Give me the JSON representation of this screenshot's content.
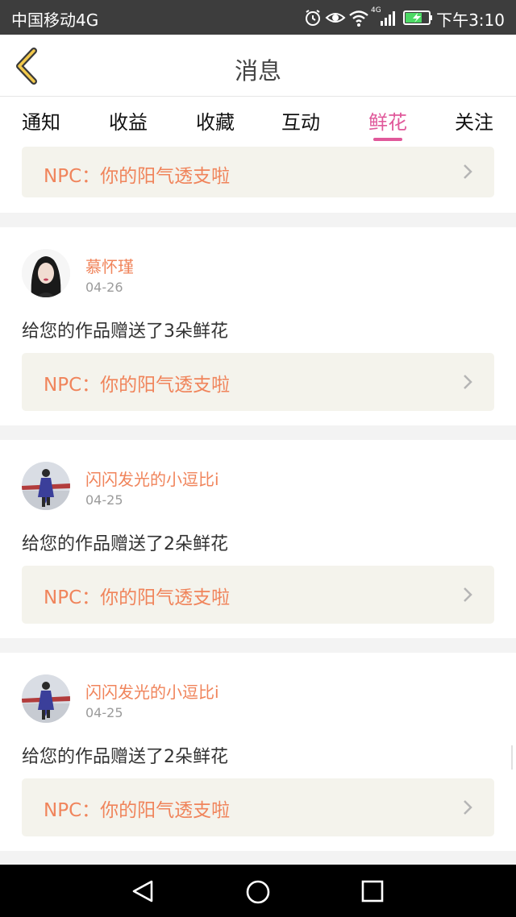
{
  "status_bar": {
    "carrier": "中国移动4G",
    "network_badge": "4G",
    "time": "下午3:10"
  },
  "header": {
    "title": "消息"
  },
  "tabs": [
    {
      "label": "通知",
      "active": false
    },
    {
      "label": "收益",
      "active": false
    },
    {
      "label": "收藏",
      "active": false
    },
    {
      "label": "互动",
      "active": false
    },
    {
      "label": "鲜花",
      "active": true
    },
    {
      "label": "关注",
      "active": false
    }
  ],
  "accent_color": "#e0589a",
  "name_color": "#f0845b",
  "top_partial_card": {
    "npc": "NPC：你的阳气透支啦"
  },
  "messages": [
    {
      "username": "慕怀瑾",
      "date": "04-26",
      "text": "给您的作品赠送了3朵鲜花",
      "npc": "NPC：你的阳气透支啦"
    },
    {
      "username": "闪闪发光的小逗比i",
      "date": "04-25",
      "text": "给您的作品赠送了2朵鲜花",
      "npc": "NPC：你的阳气透支啦"
    },
    {
      "username": "闪闪发光的小逗比i",
      "date": "04-25",
      "text": "给您的作品赠送了2朵鲜花",
      "npc": "NPC：你的阳气透支啦"
    }
  ]
}
